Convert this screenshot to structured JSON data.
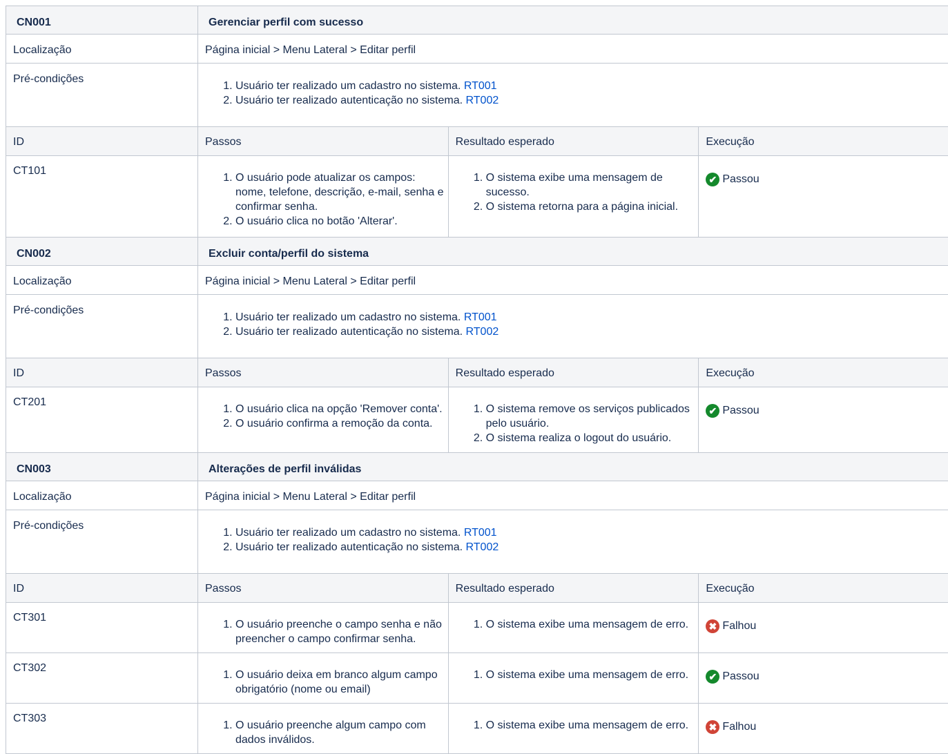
{
  "labels": {
    "location": "Localização",
    "preconditions": "Pré-condições",
    "col_id": "ID",
    "col_steps": "Passos",
    "col_expected": "Resultado esperado",
    "col_execution": "Execução"
  },
  "colors": {
    "pass": "#14892c",
    "fail": "#d04437",
    "link": "#0052cc"
  },
  "icons": {
    "pass": "check-circle-icon",
    "fail": "x-circle-icon"
  },
  "scenarios": [
    {
      "id": "CN001",
      "title": "Gerenciar perfil com sucesso",
      "location": "Página inicial > Menu Lateral > Editar perfil",
      "preconditions": [
        {
          "text": "Usuário ter realizado um cadastro no sistema. ",
          "link": "RT001"
        },
        {
          "text": "Usuário ter realizado autenticação no sistema. ",
          "link": "RT002"
        }
      ],
      "cases": [
        {
          "id": "CT101",
          "steps": [
            "O usuário pode atualizar os campos: nome, telefone, descrição, e-mail, senha e confirmar senha.",
            "O usuário clica no botão 'Alterar'."
          ],
          "expected": [
            "O sistema exibe uma mensagem de sucesso.",
            "O sistema retorna para a página inicial."
          ],
          "result": "Passou"
        }
      ]
    },
    {
      "id": "CN002",
      "title": "Excluir conta/perfil do sistema",
      "location": "Página inicial > Menu Lateral > Editar perfil",
      "preconditions": [
        {
          "text": "Usuário ter realizado um cadastro no sistema. ",
          "link": "RT001"
        },
        {
          "text": "Usuário ter realizado autenticação no sistema. ",
          "link": "RT002"
        }
      ],
      "cases": [
        {
          "id": "CT201",
          "steps": [
            "O usuário clica na opção 'Remover conta'.",
            "O usuário confirma a remoção da conta."
          ],
          "expected": [
            "O sistema remove os serviços publicados pelo usuário.",
            "O sistema realiza o logout do usuário."
          ],
          "result": "Passou"
        }
      ]
    },
    {
      "id": "CN003",
      "title": "Alterações de perfil inválidas",
      "location": "Página inicial > Menu Lateral > Editar perfil",
      "preconditions": [
        {
          "text": "Usuário ter realizado um cadastro no sistema. ",
          "link": "RT001"
        },
        {
          "text": "Usuário ter realizado autenticação no sistema. ",
          "link": "RT002"
        }
      ],
      "cases": [
        {
          "id": "CT301",
          "steps": [
            "O usuário preenche o campo senha e não preencher o campo confirmar senha."
          ],
          "expected": [
            "O sistema exibe uma mensagem de erro."
          ],
          "result": "Falhou"
        },
        {
          "id": "CT302",
          "steps": [
            "O usuário deixa em branco algum campo obrigatório (nome ou email)"
          ],
          "expected": [
            "O sistema exibe uma mensagem de erro."
          ],
          "result": "Passou"
        },
        {
          "id": "CT303",
          "steps": [
            "O usuário preenche algum campo com dados inválidos."
          ],
          "expected": [
            "O sistema exibe uma mensagem de erro."
          ],
          "result": "Falhou"
        }
      ]
    }
  ]
}
